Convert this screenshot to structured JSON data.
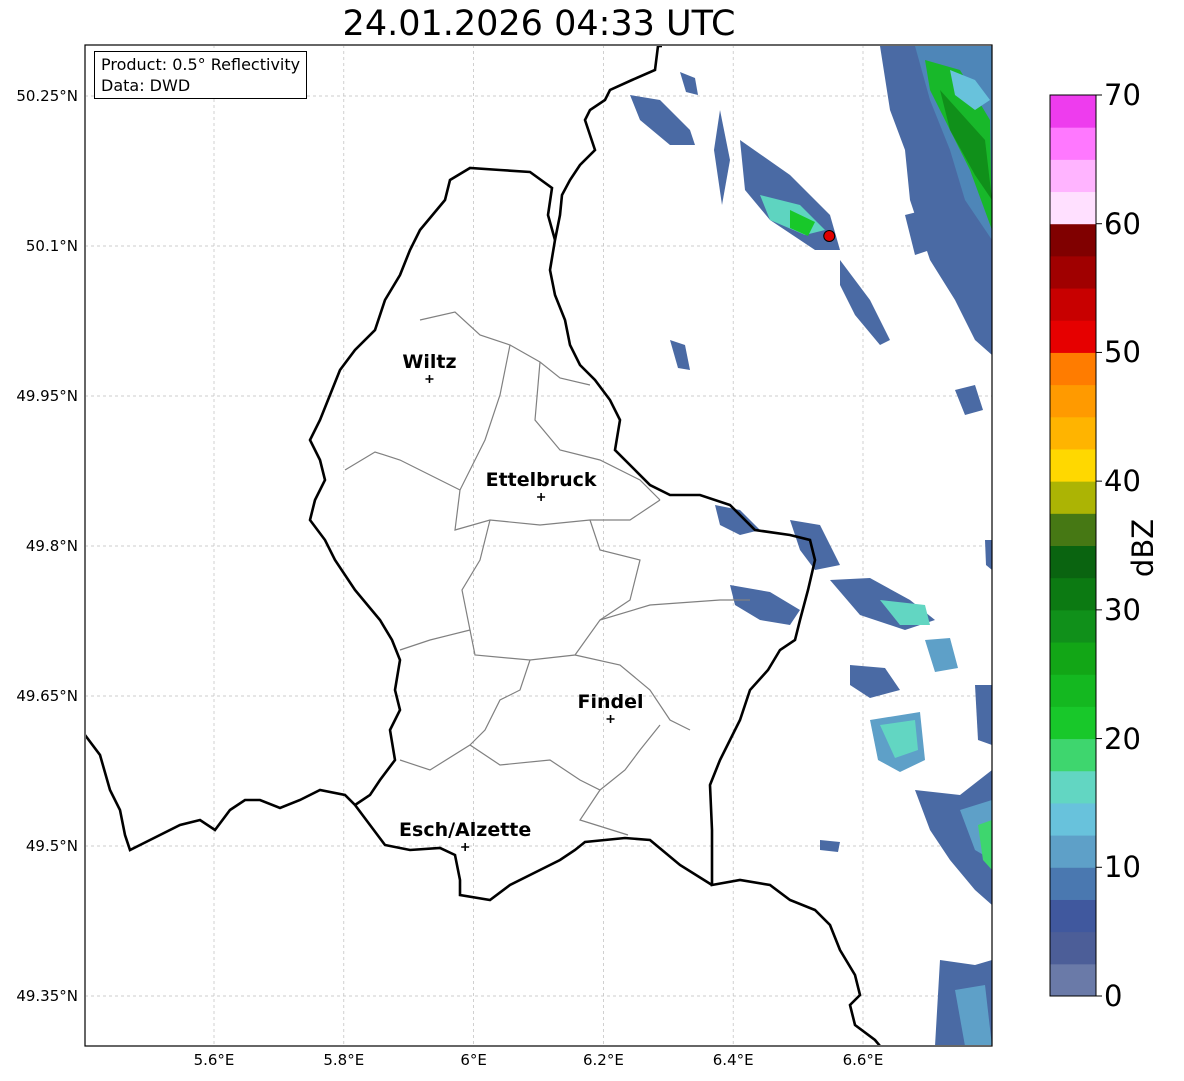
{
  "title": "24.01.2026 04:33 UTC",
  "info": {
    "product": "Product: 0.5° Reflectivity",
    "source": "Data: DWD"
  },
  "map": {
    "lon_range": [
      5.4,
      6.8
    ],
    "lat_range": [
      49.3,
      50.3
    ],
    "x_ticks": [
      "5.6°E",
      "5.8°E",
      "6°E",
      "6.2°E",
      "6.4°E",
      "6.6°E"
    ],
    "y_ticks": [
      "50.25°N",
      "50.1°N",
      "49.95°N",
      "49.8°N",
      "49.65°N",
      "49.5°N",
      "49.35°N"
    ],
    "gridlines": true,
    "radar_site": {
      "lon": 6.548,
      "lat": 50.11,
      "color": "#e00000"
    }
  },
  "cities": [
    {
      "name": "Wiltz",
      "lon": 5.932,
      "lat": 49.967
    },
    {
      "name": "Ettelbruck",
      "lon": 6.104,
      "lat": 49.849
    },
    {
      "name": "Findel",
      "lon": 6.211,
      "lat": 49.627
    },
    {
      "name": "Esch/Alzette",
      "lon": 5.987,
      "lat": 49.499
    }
  ],
  "colorbar": {
    "label": "dBZ",
    "min": 0,
    "max": 70,
    "ticks": [
      "0",
      "10",
      "20",
      "30",
      "40",
      "50",
      "60",
      "70"
    ],
    "colors": [
      "#6a7aa8",
      "#4c5e98",
      "#40589e",
      "#4a78b0",
      "#5ea0c8",
      "#68c2dc",
      "#62d6c2",
      "#3ed66e",
      "#18c82a",
      "#14b820",
      "#12a616",
      "#10901a",
      "#0c7a12",
      "#0a6410",
      "#467814",
      "#acb404",
      "#ffd800",
      "#ffb400",
      "#ff9a00",
      "#ff7c00",
      "#e60000",
      "#c80000",
      "#a00000",
      "#800000",
      "#ffe0ff",
      "#ffb4ff",
      "#ff78ff",
      "#ee3cee"
    ]
  }
}
